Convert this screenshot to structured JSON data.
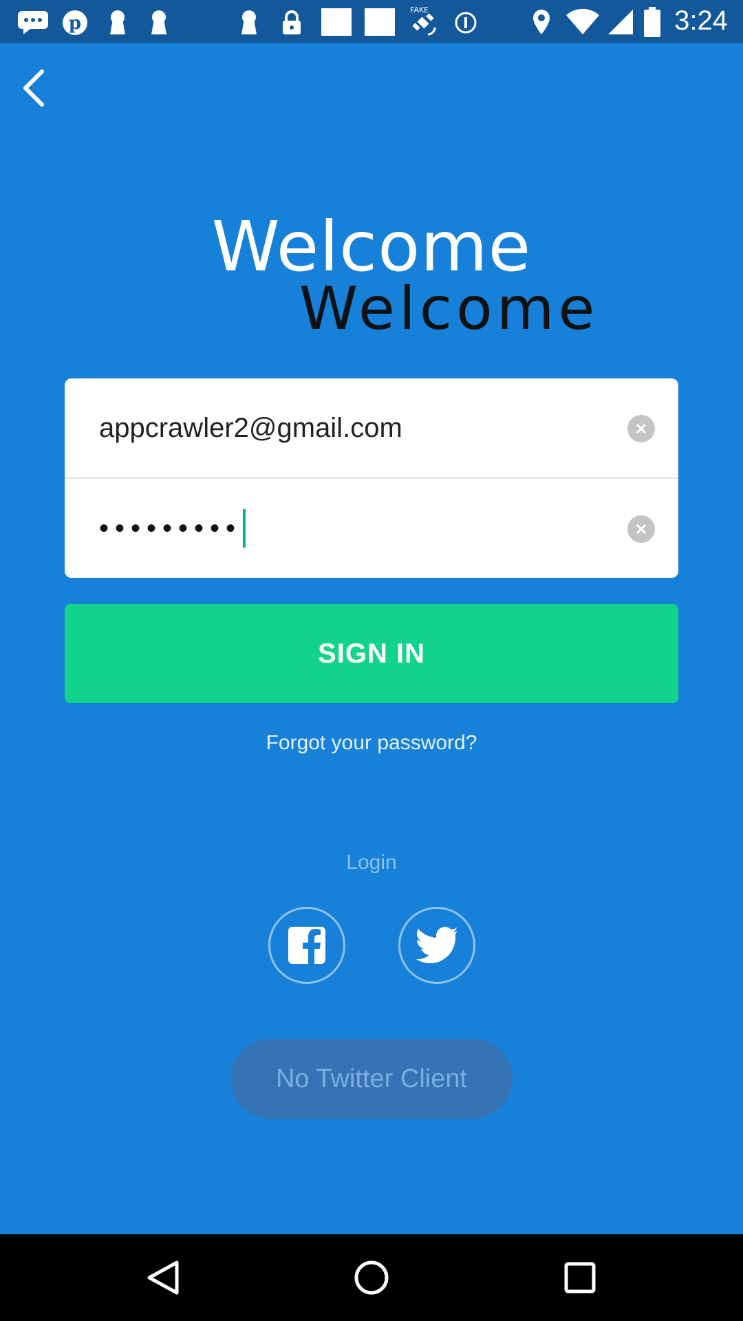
{
  "status_bar": {
    "time": "3:24",
    "left_icons": [
      "messages-icon",
      "pinterest-icon",
      "keyhole-icon",
      "keyhole-icon",
      "keyhole-icon",
      "lock-icon",
      "blank-square-icon",
      "blank-square-icon",
      "satellite-icon",
      "info-circle-icon"
    ],
    "right_icons": [
      "location-icon",
      "wifi-icon",
      "signal-icon",
      "battery-icon"
    ],
    "fake_label": "FAKE"
  },
  "header": {
    "back_icon": "chevron-left-icon"
  },
  "welcome": {
    "title": "Welcome",
    "subtitle": "Welcome"
  },
  "form": {
    "email_value": "appcrawler2@gmail.com",
    "password_masked": "•••••••••",
    "clear_icon": "clear-circle-icon"
  },
  "actions": {
    "sign_in_label": "SIGN IN",
    "forgot_label": "Forgot your password?",
    "login_label": "Login",
    "no_twitter_label": "No Twitter Client"
  },
  "social": {
    "facebook_icon": "facebook-icon",
    "twitter_icon": "twitter-icon"
  },
  "colors": {
    "background": "#1780d8",
    "status_bar": "#13589b",
    "sign_in": "#11d38b",
    "no_twitter_bg": "#3673b5"
  }
}
